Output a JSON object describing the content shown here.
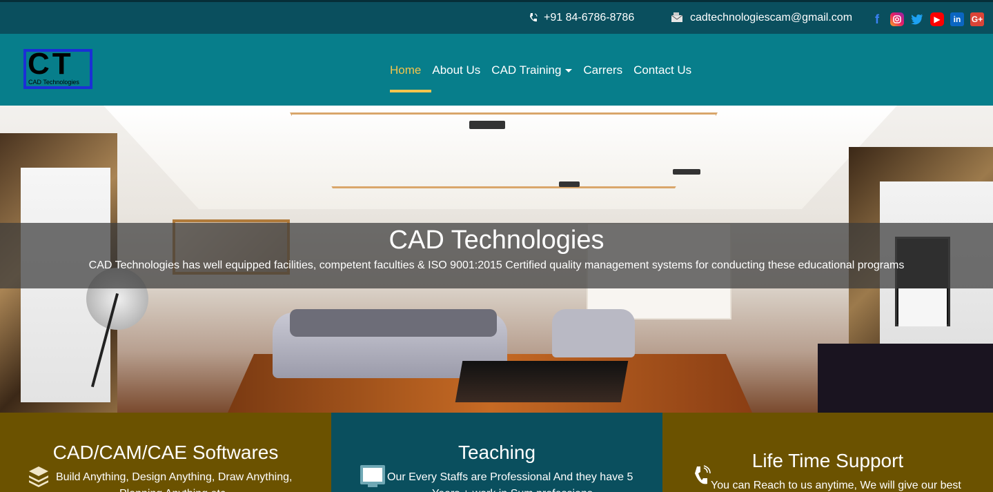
{
  "topbar": {
    "phone": "+91 84-6786-8786",
    "email": "cadtechnologiescam@gmail.com",
    "socials": [
      {
        "name": "facebook-icon",
        "glyph": "f"
      },
      {
        "name": "instagram-icon",
        "glyph": "◎"
      },
      {
        "name": "twitter-icon",
        "glyph": "🐦"
      },
      {
        "name": "youtube-icon",
        "glyph": "▶"
      },
      {
        "name": "linkedin-icon",
        "glyph": "in"
      },
      {
        "name": "google-plus-icon",
        "glyph": "G+"
      }
    ]
  },
  "brand": {
    "logo_letters": "CT",
    "logo_sub": "CAD Technologies"
  },
  "nav": {
    "items": [
      {
        "label": "Home",
        "active": true
      },
      {
        "label": "About Us",
        "active": false
      },
      {
        "label": "CAD Training",
        "active": false,
        "dropdown": true
      },
      {
        "label": "Carrers",
        "active": false
      },
      {
        "label": "Contact Us",
        "active": false
      }
    ]
  },
  "hero": {
    "title": "CAD Technologies",
    "description": "CAD Technologies has well equipped facilities, competent faculties & ISO 9001:2015 Certified quality management systems for conducting these educational programs"
  },
  "features": [
    {
      "title": "CAD/CAM/CAE Softwares",
      "text_line1": "Build Anything, Design Anything, Draw Anything,",
      "text_line2": "Planning Anything etc.",
      "icon": "layers-icon"
    },
    {
      "title": "Teaching",
      "text_line1": "Our Every Staffs are Professional And they have 5",
      "text_line2": "Years + work in Sum professions",
      "icon": "monitor-icon"
    },
    {
      "title": "Life Time Support",
      "text_line1": "You can Reach to us anytime, We will give our best",
      "text_line2": "",
      "icon": "phone-icon"
    }
  ],
  "colors": {
    "topbar": "#0a4f5e",
    "navbar": "#077e8b",
    "accent": "#f4c54d",
    "feature_gold": "#6b5200",
    "feature_teal": "#0a4f5e"
  }
}
